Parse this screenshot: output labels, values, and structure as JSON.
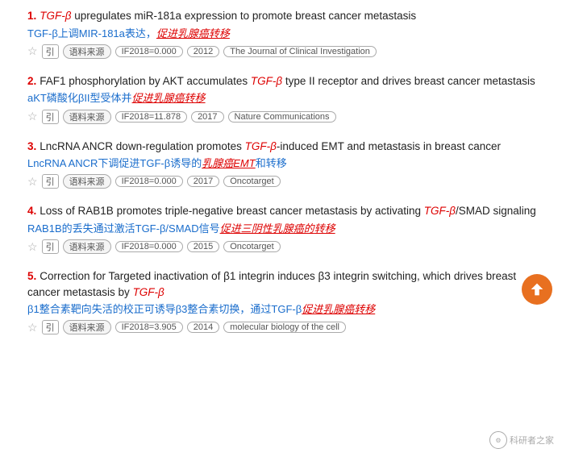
{
  "results": [
    {
      "num": "1.",
      "title_parts": [
        {
          "text": " upregulates miR-181a expression to promote breast cancer metastasis",
          "type": "normal"
        },
        {
          "text": "TGF-β",
          "type": "italic-red-prefix"
        }
      ],
      "title_text": "TGF-β upregulates miR-181a expression to promote breast cancer metastasis",
      "cn_parts": [
        {
          "text": "TGF-β上调MIR-181a表达，",
          "type": "normal-blue"
        },
        {
          "text": "促进乳腺癌转移",
          "type": "red-underline"
        }
      ],
      "cn_text": "TGF-β上调MIR-181a表达，促进乳腺癌转移",
      "if_badge": "IF2018=0.000",
      "year": "2012",
      "journal": "The Journal of Clinical Investigation"
    },
    {
      "num": "2.",
      "title_text": "FAF1 phosphorylation by AKT accumulates TGF-β type II receptor and drives breast cancer metastasis",
      "cn_text": "aKT磷酸化βII型受体并促进乳腺癌转移",
      "if_badge": "IF2018=11.878",
      "year": "2017",
      "journal": "Nature Communications"
    },
    {
      "num": "3.",
      "title_text": "LncRNA ANCR down-regulation promotes TGF-β-induced EMT and metastasis in breast cancer",
      "cn_text": "LncRNA ANCR下调促进TGF-β诱导的乳腺癌EMT和转移",
      "if_badge": "IF2018=0.000",
      "year": "2017",
      "journal": "Oncotarget"
    },
    {
      "num": "4.",
      "title_text": "Loss of RAB1B promotes triple-negative breast cancer metastasis by activating TGF-β/SMAD signaling",
      "cn_text": "RAB1B的丢失通过激活TGF-β/SMAD信号促进三阴性乳腺癌的转移",
      "if_badge": "IF2018=0.000",
      "year": "2015",
      "journal": "Oncotarget"
    },
    {
      "num": "5.",
      "title_text": "Correction for Targeted inactivation of β1 integrin induces β3 integrin switching, which drives breast cancer metastasis by TGF-β",
      "cn_text": "β1整合素靶向失活的校正可诱导β3整合素切换，通过TGF-β促进乳腺癌转移",
      "if_badge": "IF2018=3.905",
      "year": "2014",
      "journal": "molecular biology of the cell"
    }
  ],
  "labels": {
    "source": "语料来源",
    "cite": "引",
    "star": "☆",
    "watermark": "科研者之家"
  }
}
